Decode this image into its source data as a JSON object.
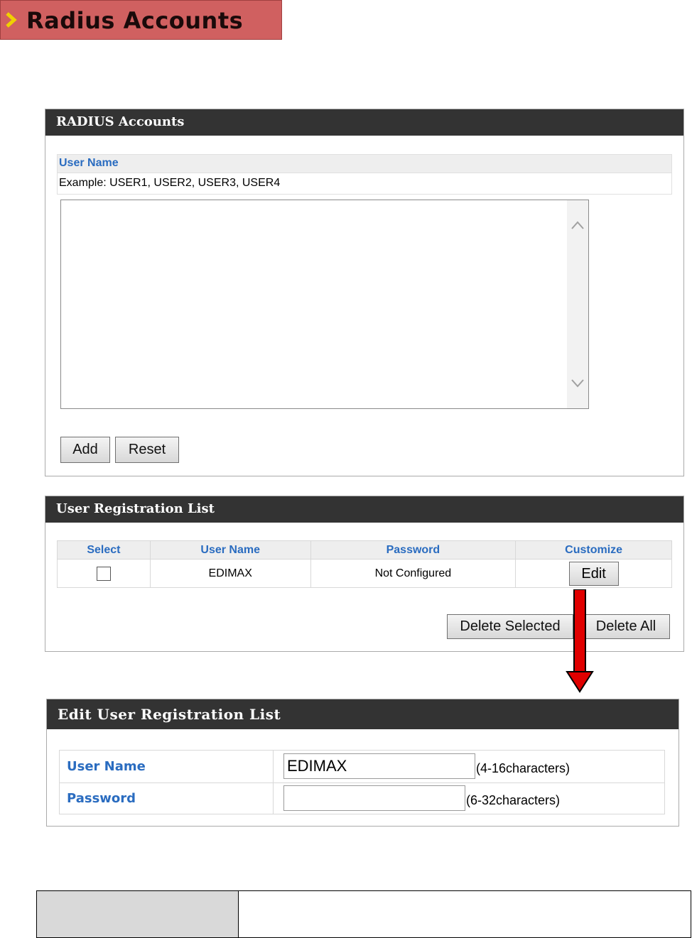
{
  "page_title": "Radius Accounts",
  "radius_panel": {
    "header": "RADIUS Accounts",
    "user_name_label": "User Name",
    "example_text": "Example: USER1, USER2, USER3, USER4",
    "textarea_value": "",
    "add_label": "Add",
    "reset_label": "Reset"
  },
  "registration_panel": {
    "header": "User Registration List",
    "columns": [
      "Select",
      "User Name",
      "Password",
      "Customize"
    ],
    "rows": [
      {
        "user_name": "EDIMAX",
        "password": "Not Configured",
        "action": "Edit",
        "selected": false
      }
    ],
    "delete_selected_label": "Delete Selected",
    "delete_all_label": "Delete All"
  },
  "edit_panel": {
    "header": "Edit User Registration List",
    "user_name_label": "User Name",
    "user_name_value": "EDIMAX",
    "user_name_hint": "(4-16characters)",
    "password_label": "Password",
    "password_value": "",
    "password_hint": "(6-32characters)"
  },
  "colors": {
    "banner": "#d06060",
    "panel_header": "#333333",
    "label_blue": "#2a6cc0",
    "arrow_red": "#e00000"
  },
  "icons": [
    "chevron-right-icon",
    "scroll-up-icon",
    "scroll-down-icon",
    "down-arrow-icon"
  ]
}
